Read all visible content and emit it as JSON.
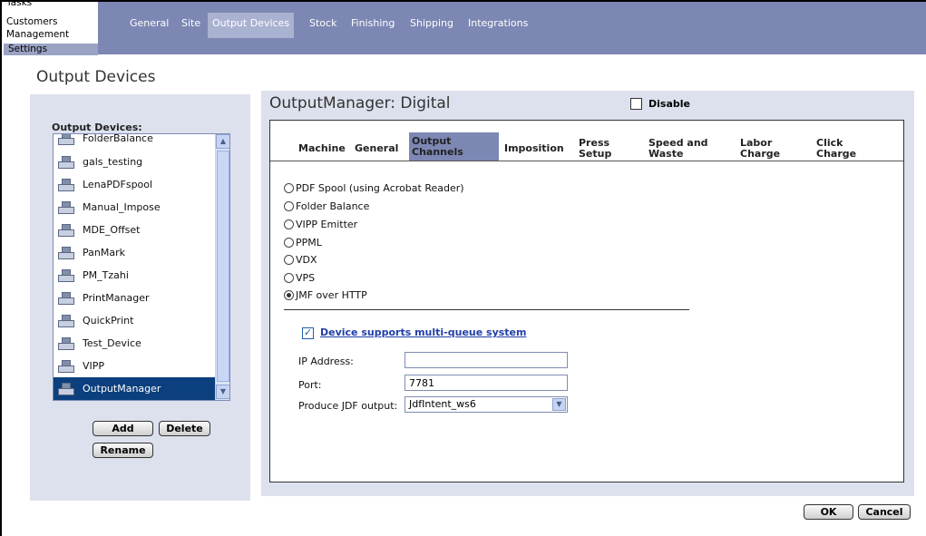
{
  "mini_menu": {
    "tasks": "Tasks",
    "customers": "Customers",
    "management": "Management",
    "settings": "Settings"
  },
  "nav": {
    "tabs": [
      {
        "label": "General"
      },
      {
        "label": "Site"
      },
      {
        "label": "Output Devices"
      },
      {
        "label": "Stock"
      },
      {
        "label": "Finishing"
      },
      {
        "label": "Shipping"
      },
      {
        "label": "Integrations"
      }
    ],
    "active_tab": "Output Devices"
  },
  "page_title": "Output Devices",
  "devices": {
    "label": "Output Devices:",
    "items": [
      "FolderBalance",
      "gals_testing",
      "LenaPDFspool",
      "Manual_Impose",
      "MDE_Offset",
      "PanMark",
      "PM_Tzahi",
      "PrintManager",
      "QuickPrint",
      "Test_Device",
      "VIPP",
      "OutputManager"
    ],
    "selected": "OutputManager",
    "add_label": "Add",
    "delete_label": "Delete",
    "rename_label": "Rename"
  },
  "detail": {
    "title": "OutputManager: Digital",
    "disable_label": "Disable",
    "disable_checked": false,
    "subtabs": [
      {
        "line1": "Machine",
        "line2": ""
      },
      {
        "line1": "General",
        "line2": ""
      },
      {
        "line1": "Output",
        "line2": "Channels"
      },
      {
        "line1": "Imposition",
        "line2": ""
      },
      {
        "line1": "Press",
        "line2": "Setup"
      },
      {
        "line1": "Speed and",
        "line2": "Waste"
      },
      {
        "line1": "Labor",
        "line2": "Charge"
      },
      {
        "line1": "Click",
        "line2": "Charge"
      }
    ],
    "active_subtab": "Output Channels",
    "channels": [
      "PDF Spool (using Acrobat Reader)",
      "Folder Balance",
      "VIPP Emitter",
      "PPML",
      "VDX",
      "VPS",
      "JMF over HTTP"
    ],
    "selected_channel": "JMF over HTTP",
    "multi_queue_label": "Device supports multi-queue system",
    "multi_queue_checked": true,
    "ip_label": "IP Address:",
    "ip_value": "",
    "port_label": "Port:",
    "port_value": "7781",
    "jdf_label": "Produce JDF output:",
    "jdf_value": "JdfIntent_ws6"
  },
  "footer": {
    "ok_label": "OK",
    "cancel_label": "Cancel"
  },
  "colors": {
    "nav_bg": "#7c87b3",
    "panel_bg": "#dde1ee",
    "selection": "#0b3f7d",
    "link_blue": "#1f3ea8"
  },
  "icons": {
    "device_item": "printer-device-icon",
    "scroll_up": "scroll-up-icon",
    "scroll_down": "scroll-down-icon",
    "dropdown": "chevron-down-icon"
  }
}
